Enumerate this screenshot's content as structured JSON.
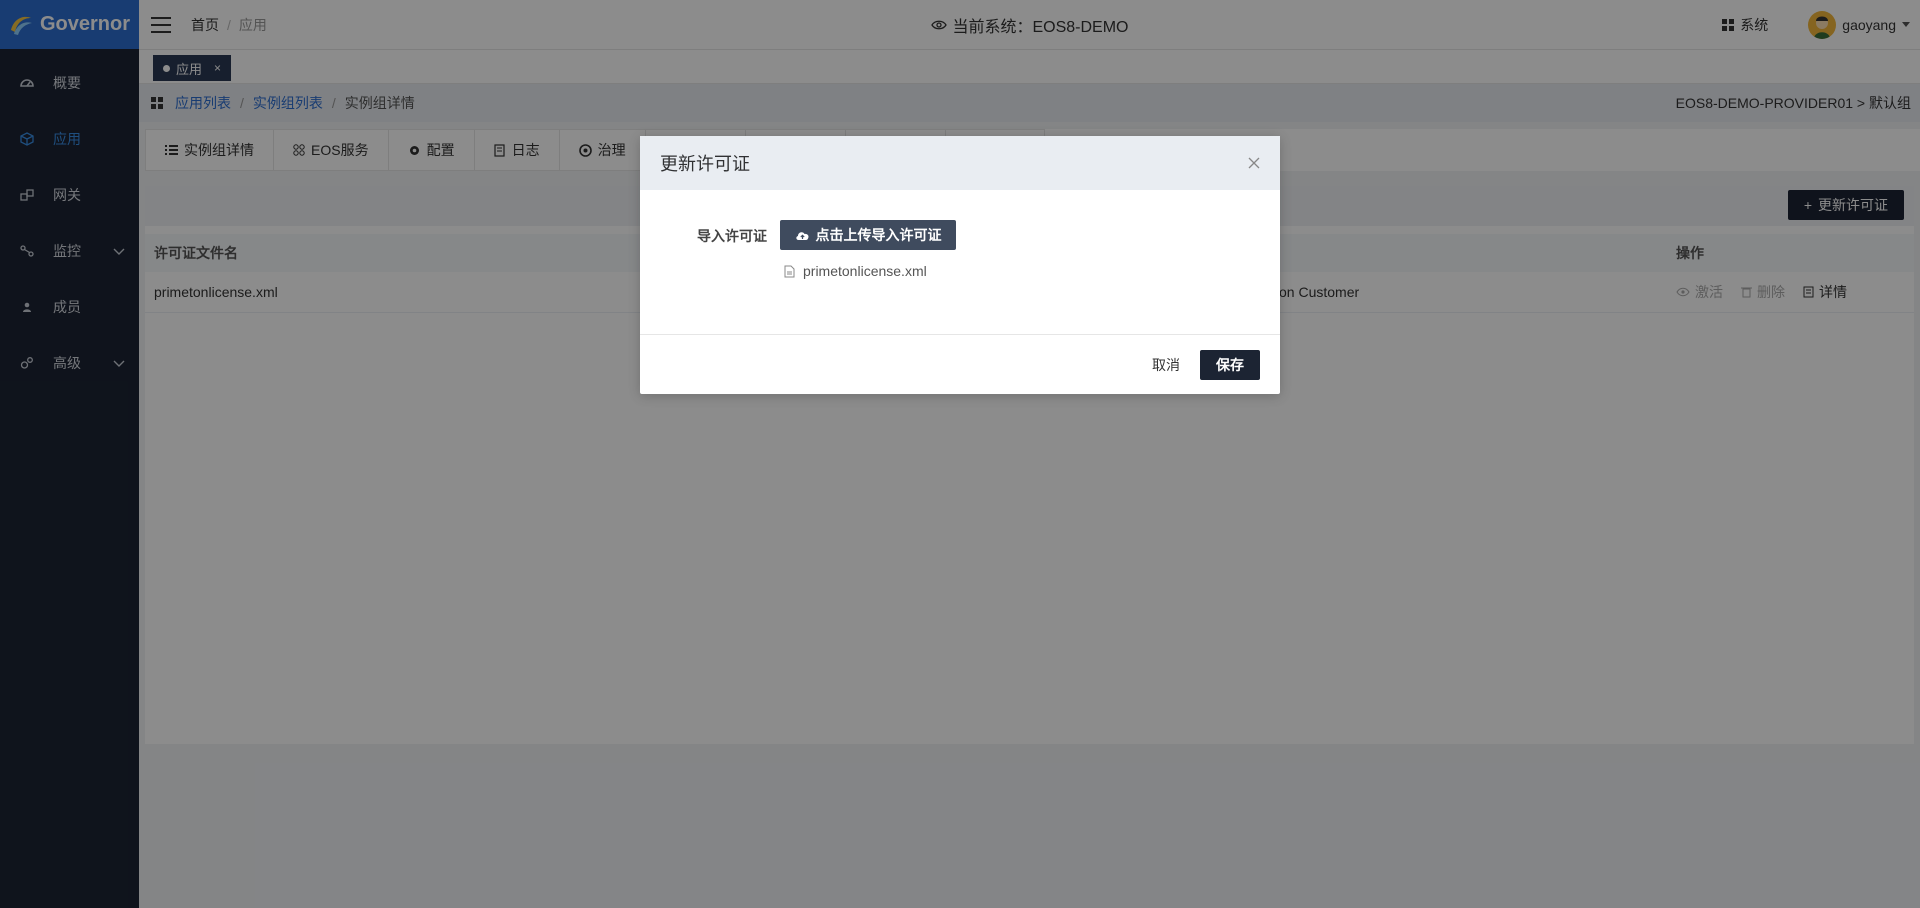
{
  "app": {
    "logo_text": "Governor"
  },
  "sidebar": {
    "items": [
      {
        "label": "概要",
        "icon": "dashboard-icon"
      },
      {
        "label": "应用",
        "icon": "cube-icon",
        "active": true
      },
      {
        "label": "网关",
        "icon": "gateway-icon"
      },
      {
        "label": "监控",
        "icon": "monitor-icon",
        "expandable": true
      },
      {
        "label": "成员",
        "icon": "user-icon"
      },
      {
        "label": "高级",
        "icon": "gears-icon",
        "expandable": true
      }
    ]
  },
  "topbar": {
    "breadcrumb": [
      "首页",
      "应用"
    ],
    "current_system": "当前系统：EOS8-DEMO",
    "system_link": "系统",
    "user": "gaoyang"
  },
  "tabstrip": {
    "tab_label": "应用",
    "close": "×"
  },
  "breadcrumb": {
    "items": [
      "应用列表",
      "实例组列表",
      "实例组详情"
    ],
    "right_info": "EOS8-DEMO-PROVIDER01 > 默认组"
  },
  "tabs": [
    {
      "label": "实例组详情",
      "icon": "list-icon"
    },
    {
      "label": "EOS服务",
      "icon": "services-icon"
    },
    {
      "label": "配置",
      "icon": "gear-icon"
    },
    {
      "label": "日志",
      "icon": "log-icon"
    },
    {
      "label": "治理",
      "icon": "governance-icon"
    }
  ],
  "content": {
    "update_button": "更新许可证",
    "table": {
      "headers": [
        "许可证文件名",
        "操作"
      ],
      "rows": [
        {
          "filename": "primetonlicense.xml",
          "customer": "on Customer",
          "ops": [
            "激活",
            "删除",
            "详情"
          ]
        }
      ]
    }
  },
  "modal": {
    "title": "更新许可证",
    "field_label": "导入许可证",
    "upload_button": "点击上传导入许可证",
    "file_name": "primetonlicense.xml",
    "cancel": "取消",
    "save": "保存"
  },
  "colors": {
    "accent": "#2d6ecf",
    "sidebar_bg": "#1c2433",
    "primary_btn": "#1c2433"
  }
}
